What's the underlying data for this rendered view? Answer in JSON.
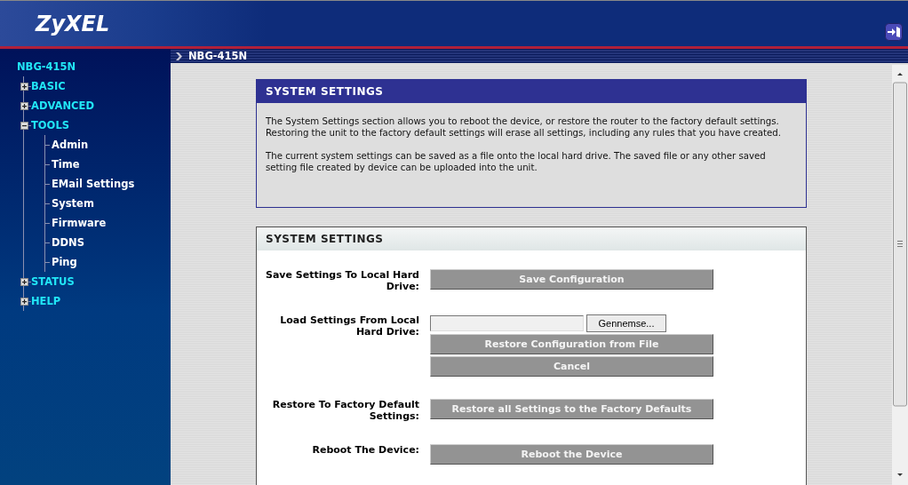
{
  "header": {
    "logo": "ZyXEL"
  },
  "breadcrumb": "NBG-415N",
  "sidebar": {
    "root": "NBG-415N",
    "items": [
      {
        "label": "BASIC",
        "expanded": false
      },
      {
        "label": "ADVANCED",
        "expanded": false
      },
      {
        "label": "TOOLS",
        "expanded": true,
        "children": [
          {
            "label": "Admin"
          },
          {
            "label": "Time"
          },
          {
            "label": "EMail Settings"
          },
          {
            "label": "System"
          },
          {
            "label": "Firmware"
          },
          {
            "label": "DDNS"
          },
          {
            "label": "Ping"
          }
        ]
      },
      {
        "label": "STATUS",
        "expanded": false
      },
      {
        "label": "HELP",
        "expanded": false
      }
    ]
  },
  "info_panel": {
    "title": "SYSTEM SETTINGS",
    "paragraphs": [
      "The System Settings section allows you to reboot the device, or restore the router to the factory default settings. Restoring the unit to the factory default settings will erase all settings, including any rules that you have created.",
      "The current system settings can be saved as a file onto the local hard drive. The saved file or any other saved setting file created by device can be uploaded into the unit."
    ]
  },
  "settings_panel": {
    "title": "SYSTEM SETTINGS",
    "rows": [
      {
        "label": "Save Settings To Local Hard Drive:",
        "controls": [
          {
            "kind": "button",
            "label": "Save Configuration"
          }
        ]
      },
      {
        "label": "Load Settings From Local Hard Drive:",
        "controls": [
          {
            "kind": "file",
            "label": "Gennemse..."
          },
          {
            "kind": "button",
            "label": "Restore Configuration from File"
          },
          {
            "kind": "button",
            "label": "Cancel"
          }
        ]
      },
      {
        "label": "Restore To Factory Default Settings:",
        "controls": [
          {
            "kind": "button",
            "label": "Restore all Settings to the Factory Defaults"
          }
        ]
      },
      {
        "label": "Reboot The Device:",
        "controls": [
          {
            "kind": "button",
            "label": "Reboot the Device"
          }
        ]
      }
    ]
  }
}
